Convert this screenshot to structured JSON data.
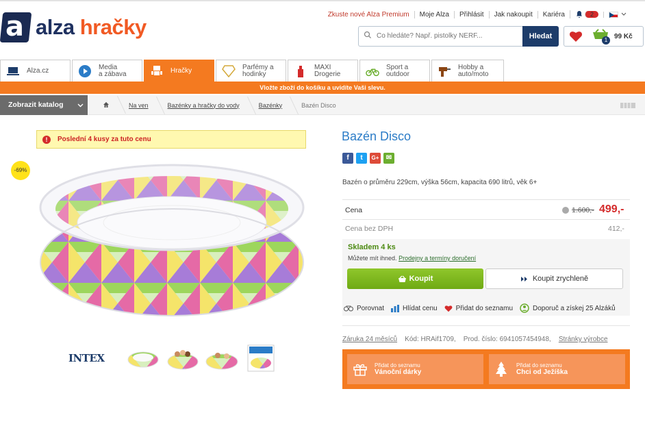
{
  "header": {
    "logo_letter": "a",
    "logo_word1": "alza",
    "logo_word2": "hračky",
    "top_links": [
      "Zkuste nové Alza Premium",
      "Moje Alza",
      "Přihlásit",
      "Jak nakoupit",
      "Kariéra"
    ],
    "notif_count": "2",
    "search_placeholder": "Co hledáte? Např. pistolky NERF...",
    "search_button": "Hledat",
    "cart_count": "1",
    "cart_price": "99 Kč"
  },
  "tabs": [
    {
      "label1": "Alza.cz",
      "label2": ""
    },
    {
      "label1": "Media",
      "label2": "a zábava"
    },
    {
      "label1": "Hračky",
      "label2": ""
    },
    {
      "label1": "Parfémy a",
      "label2": "hodinky"
    },
    {
      "label1": "MAXI",
      "label2": "Drogerie"
    },
    {
      "label1": "Sport a",
      "label2": "outdoor"
    },
    {
      "label1": "Hobby a",
      "label2": "auto/moto"
    }
  ],
  "promo_text": "Vložte zboží do košíku a uvidíte Vaši slevu.",
  "catalog_button": "Zobrazit katalog",
  "breadcrumbs": [
    "Na ven",
    "Bazénky a hračky do vody",
    "Bazénky",
    "Bazén Disco"
  ],
  "product": {
    "warning": "Poslední 4 kusy za tuto cenu",
    "discount": "-69%",
    "title": "Bazén Disco",
    "description": "Bazén o průměru 229cm, výška 56cm, kapacita 690 litrů, věk 6+",
    "price_label": "Cena",
    "old_price": "1.600,-",
    "price": "499,-",
    "price_novat_label": "Cena bez DPH",
    "price_novat": "412,-",
    "stock": "Skladem 4 ks",
    "stock_note": "Můžete mít ihned.",
    "stock_link": "Prodejny a termíny doručení",
    "buy_button": "Koupit",
    "buy_fast_button": "Koupit zrychleně",
    "actions": [
      "Porovnat",
      "Hlídat cenu",
      "Přidat do seznamu",
      "Doporuč a získej 25 Alzáků"
    ],
    "warranty": "Záruka 24 měsíců",
    "code": "Kód: HRAif1709,",
    "prod_no": "Prod. číslo: 6941057454948,",
    "maker_link": "Stránky výrobce",
    "brand": "INTEX",
    "wish1_small": "Přidat do seznamu",
    "wish1_big": "Vánoční dárky",
    "wish2_small": "Přidat do seznamu",
    "wish2_big": "Chci od Ježíška"
  },
  "colors": {
    "orange": "#f47a20",
    "navy": "#1d3c6a",
    "green": "#7ab51d",
    "red": "#d42b2b",
    "link_blue": "#2b7cc7"
  }
}
